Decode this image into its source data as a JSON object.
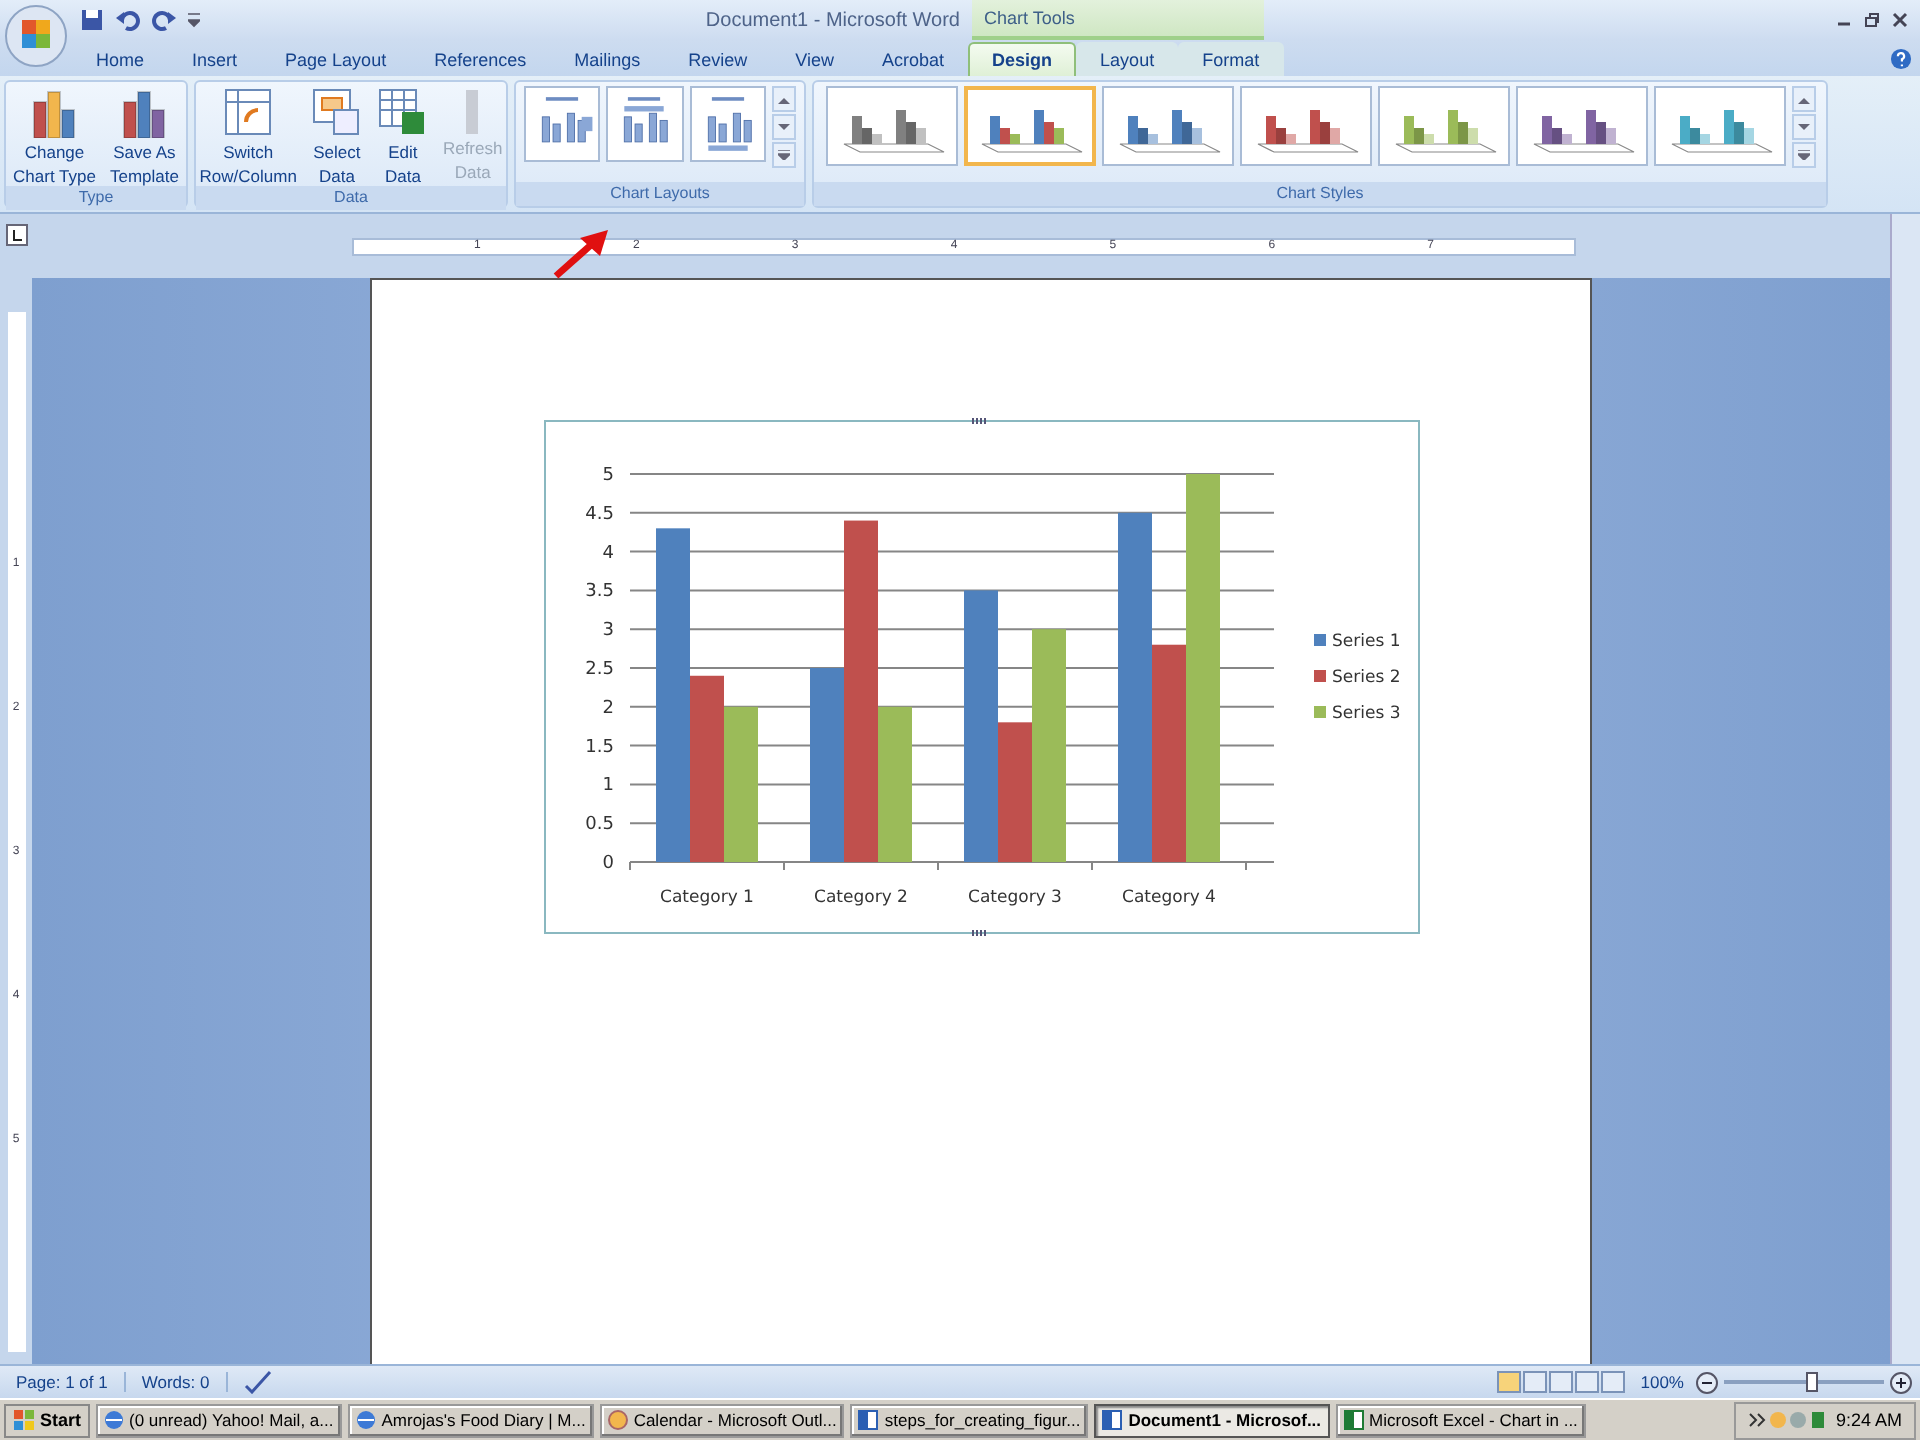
{
  "window": {
    "title": "Document1 - Microsoft Word",
    "context_group": "Chart Tools"
  },
  "tabs": [
    {
      "label": "Home",
      "selected": false,
      "contextual": false
    },
    {
      "label": "Insert",
      "selected": false,
      "contextual": false
    },
    {
      "label": "Page Layout",
      "selected": false,
      "contextual": false
    },
    {
      "label": "References",
      "selected": false,
      "contextual": false
    },
    {
      "label": "Mailings",
      "selected": false,
      "contextual": false
    },
    {
      "label": "Review",
      "selected": false,
      "contextual": false
    },
    {
      "label": "View",
      "selected": false,
      "contextual": false
    },
    {
      "label": "Acrobat",
      "selected": false,
      "contextual": false
    },
    {
      "label": "Design",
      "selected": true,
      "contextual": true
    },
    {
      "label": "Layout",
      "selected": false,
      "contextual": true
    },
    {
      "label": "Format",
      "selected": false,
      "contextual": true
    }
  ],
  "ribbon": {
    "type_group": {
      "label": "Type",
      "buttons": [
        {
          "lines": [
            "Change",
            "Chart Type"
          ],
          "disabled": false,
          "kind": "change"
        },
        {
          "lines": [
            "Save As",
            "Template"
          ],
          "disabled": false,
          "kind": "template"
        }
      ]
    },
    "data_group": {
      "label": "Data",
      "buttons": [
        {
          "lines": [
            "Switch",
            "Row/Column"
          ],
          "disabled": false,
          "kind": "switch"
        },
        {
          "lines": [
            "Select",
            "Data"
          ],
          "disabled": false,
          "kind": "select"
        },
        {
          "lines": [
            "Edit",
            "Data"
          ],
          "disabled": false,
          "kind": "edit"
        },
        {
          "lines": [
            "Refresh",
            "Data"
          ],
          "disabled": true,
          "kind": "refresh"
        }
      ]
    },
    "layouts_group": {
      "label": "Chart Layouts",
      "layouts": [
        {
          "kind": "legend-right",
          "selected": false
        },
        {
          "kind": "legend-top",
          "selected": false
        },
        {
          "kind": "legend-bottom",
          "selected": false
        }
      ]
    },
    "styles_group": {
      "label": "Chart Styles",
      "styles": [
        {
          "kind": "mono",
          "color": "#808080",
          "selected": false
        },
        {
          "kind": "colorful",
          "color": "#4f81bd",
          "selected": true
        },
        {
          "kind": "mono",
          "color": "#4f81bd",
          "selected": false
        },
        {
          "kind": "mono",
          "color": "#c0504d",
          "selected": false
        },
        {
          "kind": "mono",
          "color": "#9bbb59",
          "selected": false
        },
        {
          "kind": "mono",
          "color": "#8064a2",
          "selected": false
        },
        {
          "kind": "mono",
          "color": "#4bacc6",
          "selected": false
        }
      ]
    }
  },
  "ruler": {
    "marks": [
      "1",
      "2",
      "3",
      "4",
      "5",
      "6",
      "7"
    ]
  },
  "vertical_ruler": {
    "marks": [
      "1",
      "2",
      "3",
      "4",
      "5"
    ]
  },
  "chart_data": {
    "type": "bar",
    "categories": [
      "Category 1",
      "Category 2",
      "Category 3",
      "Category 4"
    ],
    "series": [
      {
        "name": "Series 1",
        "color": "#4f81bd",
        "values": [
          4.3,
          2.5,
          3.5,
          4.5
        ]
      },
      {
        "name": "Series 2",
        "color": "#c0504d",
        "values": [
          2.4,
          4.4,
          1.8,
          2.8
        ]
      },
      {
        "name": "Series 3",
        "color": "#9bbb59",
        "values": [
          2,
          2,
          3,
          5
        ]
      }
    ],
    "grid": true,
    "legend": "right",
    "ylim": [
      0,
      5
    ],
    "yticks": [
      0,
      {
        "value": 0.5,
        "label": "0.5"
      },
      1,
      {
        "value": 1.5,
        "label": "1.5"
      },
      2,
      {
        "value": 2.5,
        "label": "2.5"
      },
      3,
      {
        "value": 3.5,
        "label": "3.5"
      },
      4,
      {
        "value": 4.5,
        "label": "4.5"
      },
      5
    ]
  },
  "status_bar": {
    "page": "Page: 1 of 1",
    "words": "Words: 0",
    "zoom": "100%",
    "zoom_level": {
      "level": 0.55
    }
  },
  "taskbar": {
    "start": "Start",
    "items": [
      {
        "label": "(0 unread) Yahoo! Mail, a...",
        "selected": false,
        "kind": "browser"
      },
      {
        "label": "Amrojas's Food Diary | M...",
        "selected": false,
        "kind": "browser"
      },
      {
        "label": "Calendar - Microsoft Outl...",
        "selected": false,
        "kind": "outlook"
      },
      {
        "label": "steps_for_creating_figur...",
        "selected": false,
        "kind": "word"
      },
      {
        "label": "Document1 - Microsof...",
        "selected": true,
        "kind": "word"
      },
      {
        "label": "Microsoft Excel - Chart in ...",
        "selected": false,
        "kind": "excel"
      }
    ],
    "clock": "9:24 AM"
  }
}
